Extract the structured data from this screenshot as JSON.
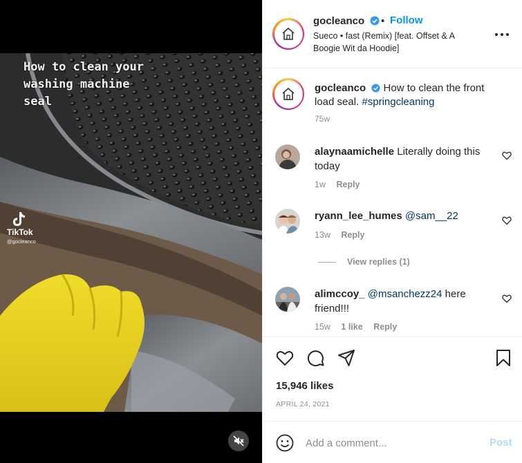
{
  "video": {
    "overlay_text": "How to clean your\nwashing machine\nseal",
    "watermark": {
      "name": "TikTok",
      "handle": "@gocleanco"
    }
  },
  "header": {
    "username": "gocleanco",
    "separator": "•",
    "follow_label": "Follow",
    "audio": "Sueco • fast (Remix) [feat. Offset & A Boogie Wit da Hoodie]"
  },
  "caption": {
    "username": "gocleanco",
    "text": "How to clean the front load seal.",
    "hashtag": "#springcleaning",
    "time": "75w"
  },
  "comments": [
    {
      "username": "alaynaamichelle",
      "mention": "",
      "text": "Literally doing this today",
      "time": "1w",
      "likes": "",
      "reply_label": "Reply"
    },
    {
      "username": "ryann_lee_humes",
      "mention": "@sam__22",
      "text": "",
      "time": "13w",
      "likes": "",
      "reply_label": "Reply"
    },
    {
      "username": "alimccoy_",
      "mention": "@msanchezz24",
      "text": "here friend!!!",
      "time": "15w",
      "likes": "1 like",
      "reply_label": "Reply"
    }
  ],
  "view_replies_label": "View replies (1)",
  "likes": "15,946 likes",
  "date": "APRIL 24, 2021",
  "add_comment": {
    "placeholder": "Add a comment...",
    "post_label": "Post"
  },
  "colors": {
    "accent": "#0095f6",
    "post_disabled": "#b3dbff",
    "hashtag": "#00376b",
    "muted": "#8e8e8e",
    "glove": "#e8d21e"
  },
  "icons": [
    "home-logo-icon",
    "verified-badge-icon",
    "more-options-icon",
    "heart-icon",
    "comment-icon",
    "share-icon",
    "save-icon",
    "emoji-icon",
    "mute-icon",
    "tiktok-icon"
  ]
}
